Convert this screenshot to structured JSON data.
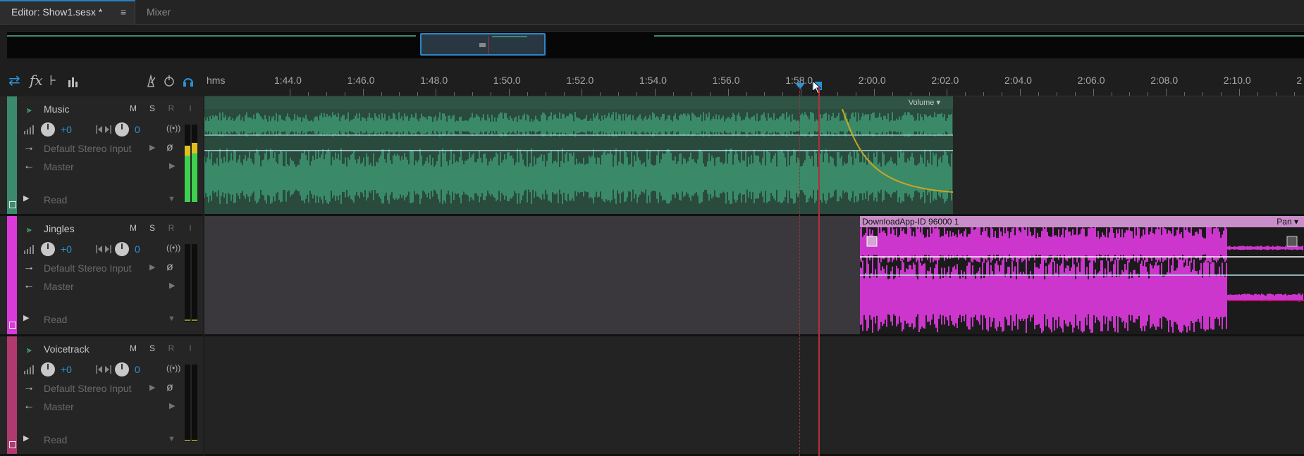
{
  "tabs": {
    "editor": "Editor: Show1.sesx *",
    "editor_menu": "≡",
    "mixer": "Mixer"
  },
  "ruler": {
    "unit_label": "hms",
    "ticks": [
      "1:44.0",
      "1:46.0",
      "1:48.0",
      "1:50.0",
      "1:52.0",
      "1:54.0",
      "1:56.0",
      "1:58.0",
      "2:00.0",
      "2:02.0",
      "2:04.0",
      "2:06.0",
      "2:08.0",
      "2:10.0",
      "2"
    ]
  },
  "toolbar": {
    "icons": [
      "switch-icon",
      "fx-icon",
      "send-icon",
      "meter-icon"
    ],
    "right_icons": [
      "metronome-icon",
      "record-icon",
      "headphone-icon"
    ]
  },
  "colors": {
    "music": "#3c8a6e",
    "jingles": "#d93ad9",
    "voicetrack": "#b03a70",
    "playhead": "#c0303a",
    "fade": "#c9a622"
  },
  "tracks": [
    {
      "name": "Music",
      "m": "M",
      "s": "S",
      "r": "R",
      "i": "I",
      "volume": "+0",
      "pan": "0",
      "input": "Default Stereo Input",
      "output": "Master",
      "automation": "Read"
    },
    {
      "name": "Jingles",
      "m": "M",
      "s": "S",
      "r": "R",
      "i": "I",
      "volume": "+0",
      "pan": "0",
      "input": "Default Stereo Input",
      "output": "Master",
      "automation": "Read"
    },
    {
      "name": "Voicetrack",
      "m": "M",
      "s": "S",
      "r": "R",
      "i": "I",
      "volume": "+0",
      "pan": "0",
      "input": "Default Stereo Input",
      "output": "Master",
      "automation": "Read"
    }
  ],
  "clips": {
    "music_envelope": "Volume",
    "jingle_name": "DownloadApp-ID 96000 1",
    "jingle_envelope": "Pan"
  }
}
